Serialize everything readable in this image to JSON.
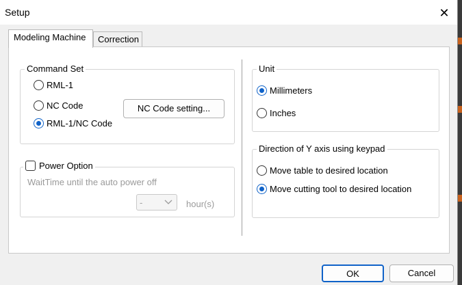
{
  "window": {
    "title": "Setup",
    "close_glyph": "✕"
  },
  "tabs": [
    {
      "label": "Modeling Machine",
      "active": true
    },
    {
      "label": "Correction",
      "active": false
    }
  ],
  "command_set": {
    "legend": "Command Set",
    "options": [
      {
        "label": "RML-1",
        "selected": false
      },
      {
        "label": "NC Code",
        "selected": false
      },
      {
        "label": "RML-1/NC Code",
        "selected": true
      }
    ],
    "nc_button": "NC Code setting..."
  },
  "power_option": {
    "label": "Power Option",
    "checked": false,
    "wait_label": "WaitTime until the auto power off",
    "combo_value": "-",
    "unit": "hour(s)"
  },
  "unit": {
    "legend": "Unit",
    "options": [
      {
        "label": "Millimeters",
        "selected": true
      },
      {
        "label": "Inches",
        "selected": false
      }
    ]
  },
  "direction": {
    "legend": "Direction of Y axis using keypad",
    "options": [
      {
        "label": "Move table to desired location",
        "selected": false
      },
      {
        "label": "Move cutting tool to desired location",
        "selected": true
      }
    ]
  },
  "footer": {
    "ok": "OK",
    "cancel": "Cancel"
  },
  "colors": {
    "accent": "#0f62c8",
    "background_app_accent": "#c8621e"
  }
}
